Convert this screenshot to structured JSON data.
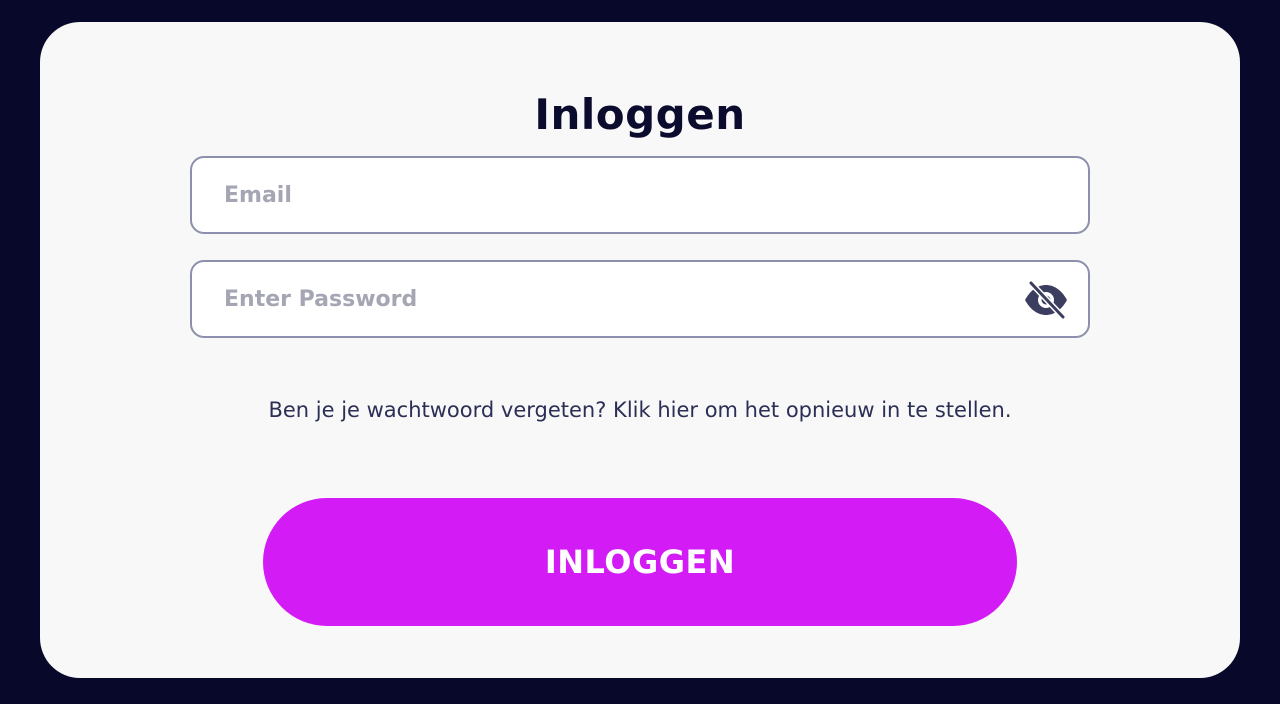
{
  "login": {
    "title": "Inloggen",
    "email": {
      "value": "",
      "placeholder": "Email"
    },
    "password": {
      "value": "",
      "placeholder": "Enter Password",
      "toggle_icon": "eye-slash-icon"
    },
    "forgot_link": "Ben je je wachtwoord vergeten? Klik hier om het opnieuw in te stellen.",
    "submit_label": "INLOGGEN"
  },
  "colors": {
    "background": "#07082a",
    "card": "#f8f8f8",
    "accent": "#d31cf5",
    "text": "#0b0b2e",
    "border": "#8c90ad",
    "placeholder": "#a4a6b3"
  }
}
